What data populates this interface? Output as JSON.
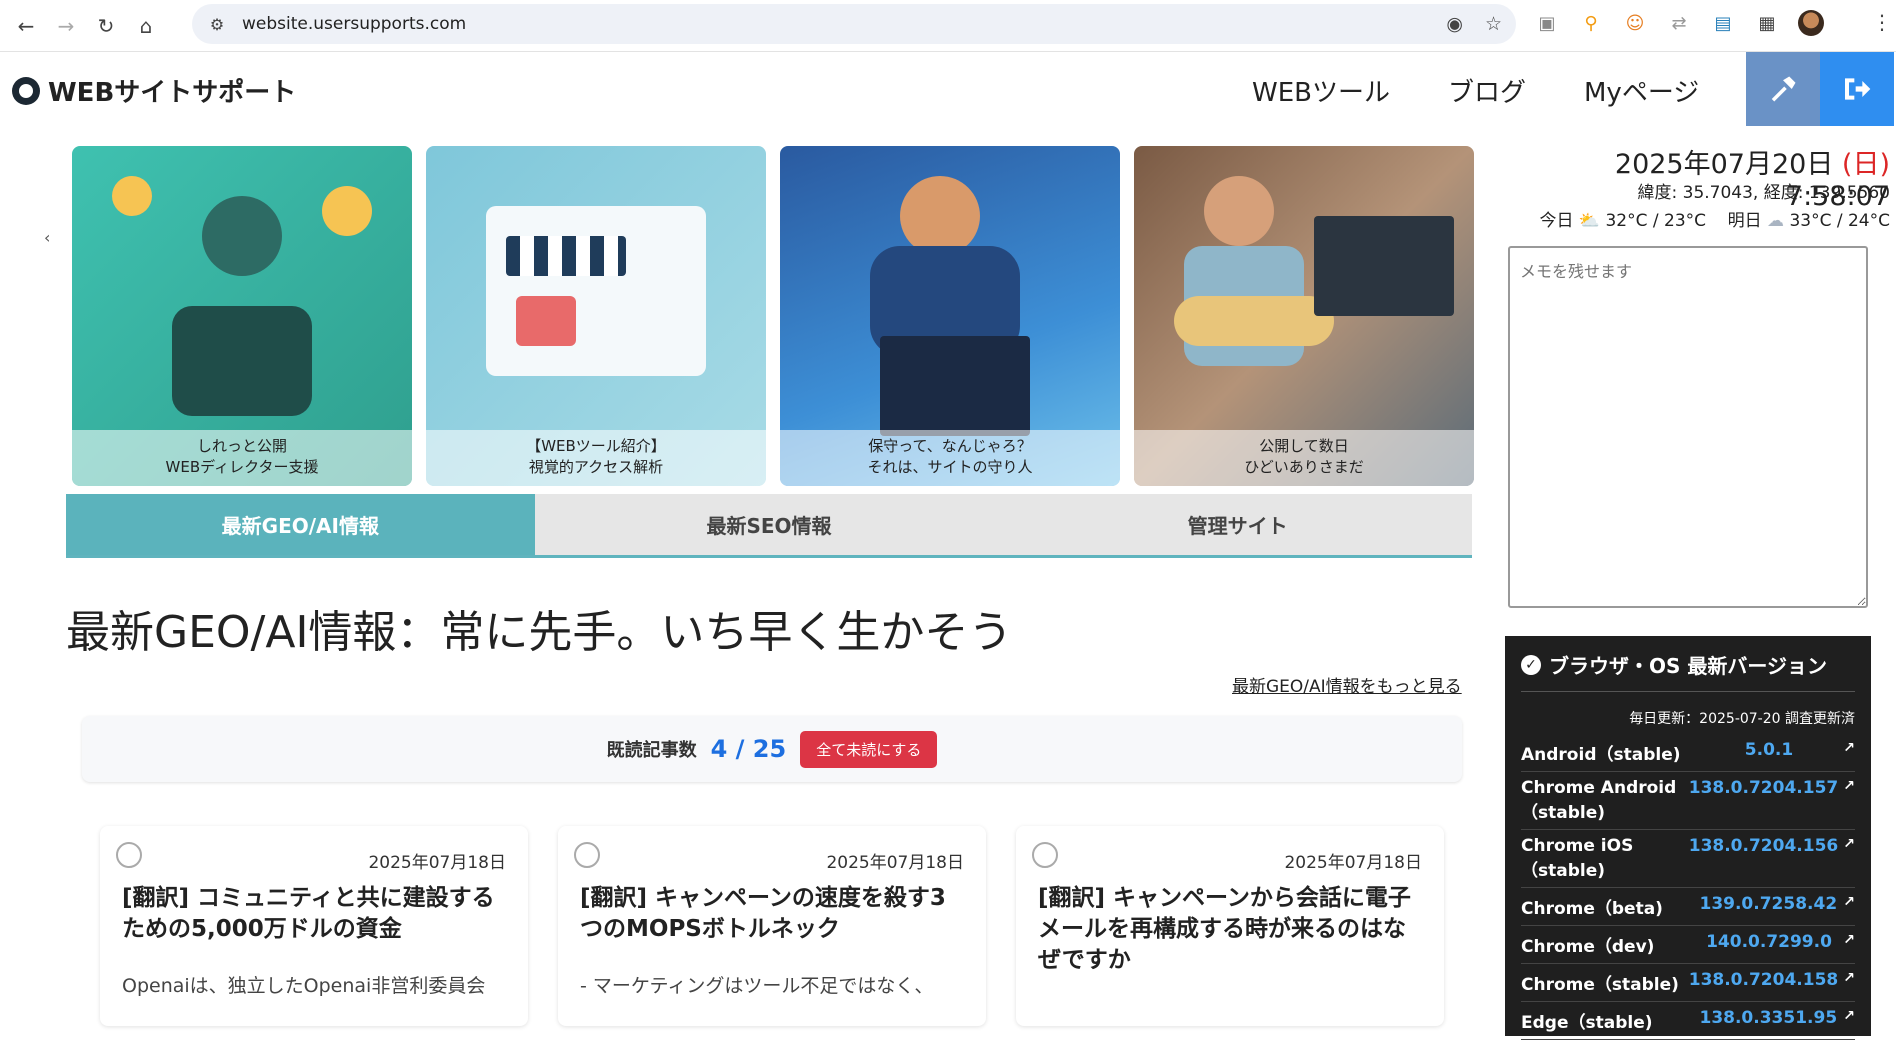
{
  "browser": {
    "url": "website.usersupports.com"
  },
  "site": {
    "title": "WEBサイトサポート",
    "nav": [
      "WEBツール",
      "ブログ",
      "Myページ"
    ]
  },
  "carousel": [
    {
      "line1": "しれっと公開",
      "line2": "WEBディレクター支援"
    },
    {
      "line1": "【WEBツール紹介】",
      "line2": "視覚的アクセス解析"
    },
    {
      "line1": "保守って、なんじゃろ？",
      "line2": "それは、サイトの守り人"
    },
    {
      "line1": "公開して数日",
      "line2": "ひどいありさまだ"
    }
  ],
  "tabs": [
    "最新GEO/AI情報",
    "最新SEO情報",
    "管理サイト"
  ],
  "main": {
    "headline": "最新GEO/AI情報：常に先手。いち早く生かそう",
    "more_link": "最新GEO/AI情報をもっと見る",
    "read_label": "既読記事数",
    "read_count": "4 / 25",
    "unread_button": "全て未読にする"
  },
  "articles": [
    {
      "date": "2025年07月18日",
      "title": "[翻訳] コミュニティと共に建設するための5,000万ドルの資金",
      "excerpt": "Openaiは、独立したOpenai非営利委員会"
    },
    {
      "date": "2025年07月18日",
      "title": "[翻訳] キャンペーンの速度を殺す3つのMOPSボトルネック",
      "excerpt": "- マーケティングはツール不足ではなく、"
    },
    {
      "date": "2025年07月18日",
      "title": "[翻訳] キャンペーンから会話に電子メールを再構成する時が来るのはなぜですか",
      "excerpt": ""
    }
  ],
  "sidebar": {
    "date": "2025年07月20日",
    "weekday": "(日)",
    "time": "7:58:07",
    "coords": "緯度: 35.7043, 経度: 139.5560",
    "today_label": "今日",
    "today_temp": "32°C / 23°C",
    "tomorrow_label": "明日",
    "tomorrow_temp": "33°C / 24°C",
    "memo_placeholder": "メモを残せます",
    "versions_title": "ブラウザ・OS 最新バージョン",
    "versions_updated": "毎日更新：2025-07-20 調査更新済",
    "versions": [
      {
        "name": "Android（stable)",
        "version": "5.0.1"
      },
      {
        "name": "Chrome Android（stable)",
        "version": "138.0.7204.157"
      },
      {
        "name": "Chrome iOS（stable)",
        "version": "138.0.7204.156"
      },
      {
        "name": "Chrome（beta)",
        "version": "139.0.7258.42"
      },
      {
        "name": "Chrome（dev)",
        "version": "140.0.7299.0"
      },
      {
        "name": "Chrome（stable)",
        "version": "138.0.7204.158"
      },
      {
        "name": "Edge（stable)",
        "version": "138.0.3351.95"
      }
    ]
  },
  "colors": {
    "accent": "#5bb3bc",
    "link_blue": "#1d6fe0",
    "danger": "#dc3545",
    "sunday_red": "#dc2626"
  }
}
